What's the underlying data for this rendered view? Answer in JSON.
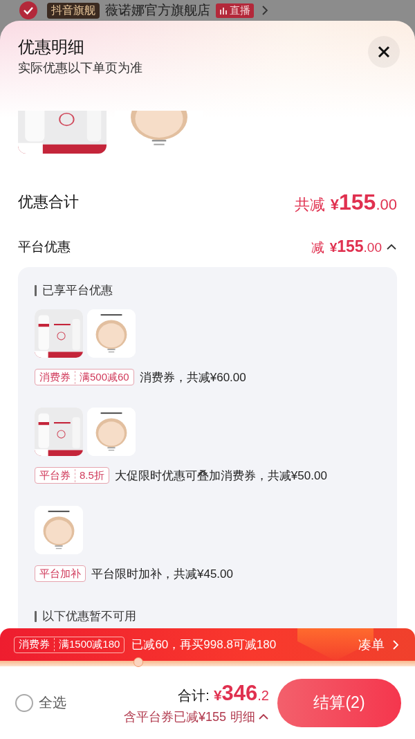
{
  "store_bar": {
    "checked": true,
    "badge": "抖音旗舰",
    "name": "薇诺娜官方旗舰店",
    "live": "直播"
  },
  "sheet": {
    "title": "优惠明细",
    "subtitle": "实际优惠以下单页为准"
  },
  "products": [
    {
      "kind": "cleanser"
    },
    {
      "kind": "compact"
    }
  ],
  "summary": [
    {
      "kind": "total",
      "label": "优惠合计",
      "prefix": "共减",
      "currency": "¥",
      "integer": "155",
      "decimal": ".00"
    },
    {
      "kind": "platform",
      "label": "平台优惠",
      "prefix": "减",
      "currency": "¥",
      "integer": "155",
      "decimal": ".00",
      "expanded": true
    }
  ],
  "sections": [
    {
      "heading": "已享平台优惠",
      "discounts": [
        {
          "products": [
            {
              "kind": "cleanser"
            },
            {
              "kind": "compact"
            }
          ],
          "tag": "消费券",
          "condition": "满500减60",
          "text": "消费券，共减¥60.00"
        },
        {
          "products": [
            {
              "kind": "cleanser"
            },
            {
              "kind": "compact"
            }
          ],
          "tag": "平台券",
          "condition": "8.5折",
          "text": "大促限时优惠可叠加消费券，共减¥50.00"
        },
        {
          "products": [
            {
              "kind": "compact"
            }
          ],
          "tag": "平台加补",
          "text": "平台限时加补，共减¥45.00"
        }
      ]
    },
    {
      "heading": "以下优惠暂不可用"
    }
  ],
  "promo_bar": {
    "tag": "消费券",
    "condition": "满1500减180",
    "text": "已减60，再买998.8可减180",
    "action": "凑单"
  },
  "footer": {
    "select_all": {
      "label": "全选",
      "checked": false
    },
    "total_label": "合计:",
    "currency": "¥",
    "integer": "346",
    "decimal": ".2",
    "saved": "含平台券已减¥155",
    "detail": "明细",
    "detail_expanded": true,
    "checkout": "结算(2)"
  }
}
